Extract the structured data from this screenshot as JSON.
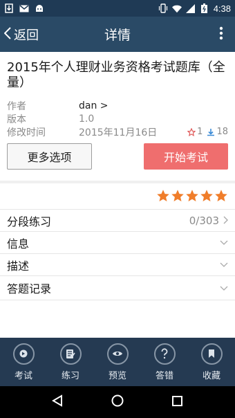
{
  "status_bar": {
    "time": "4:38"
  },
  "app_bar": {
    "back_label": "返回",
    "title": "详情"
  },
  "book": {
    "title": "2015年个人理财业务资格考试题库（全量）",
    "meta": [
      {
        "key": "作者",
        "value": "dan >"
      },
      {
        "key": "版本",
        "value": "1.0"
      },
      {
        "key": "修改时间",
        "value": "2015年11月16日"
      }
    ],
    "favorites": "1",
    "downloads": "18"
  },
  "actions": {
    "more_options": "更多选项",
    "start_exam": "开始考试"
  },
  "rating": {
    "stars": 5,
    "max": 5,
    "color": "#f07d2a"
  },
  "sections": [
    {
      "label": "分段练习",
      "value": "0/303"
    },
    {
      "label": "信息"
    },
    {
      "label": "描述"
    },
    {
      "label": "答题记录"
    }
  ],
  "bottom_nav": [
    {
      "label": "考试",
      "icon": "exam-icon"
    },
    {
      "label": "练习",
      "icon": "practice-icon"
    },
    {
      "label": "预览",
      "icon": "eye-icon"
    },
    {
      "label": "答错",
      "icon": "question-icon"
    },
    {
      "label": "收藏",
      "icon": "bookmark-icon"
    }
  ],
  "colors": {
    "app_bar": "#2a4a66",
    "start_button": "#ef6e6e",
    "bottom_nav": "#253a52"
  }
}
